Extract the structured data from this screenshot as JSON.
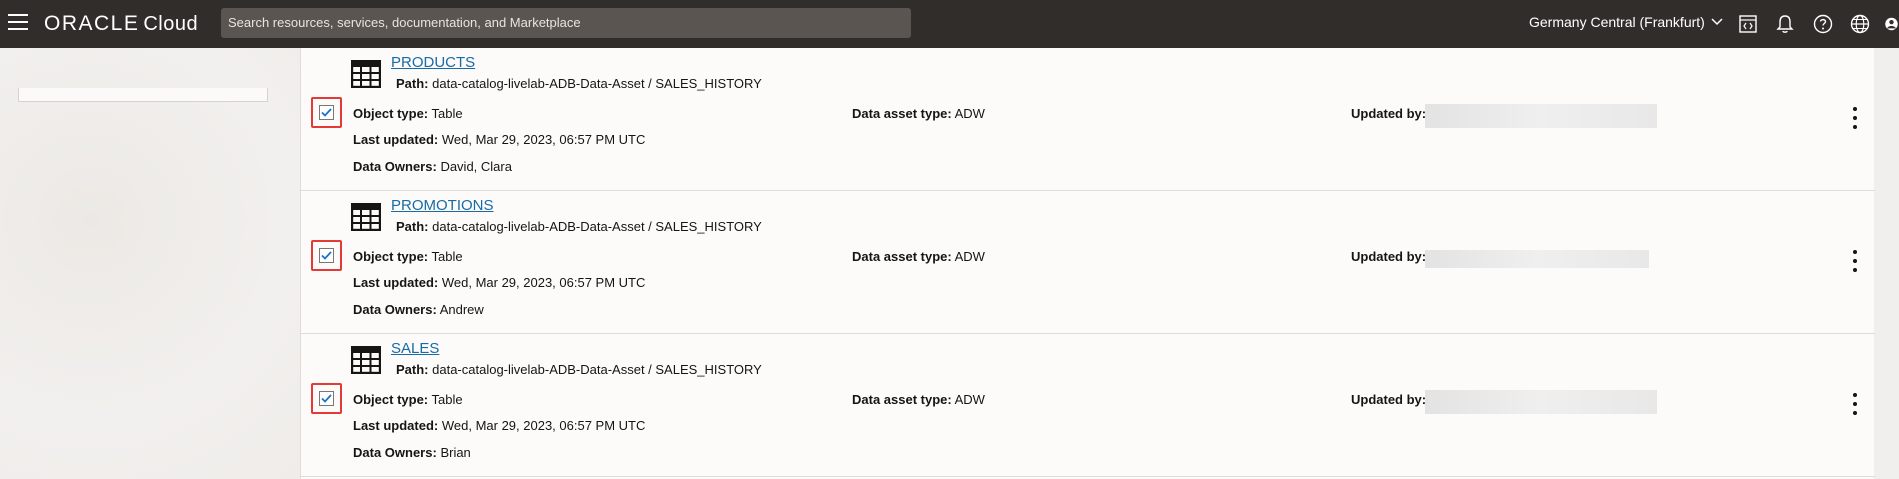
{
  "header": {
    "logo_brand": "ORACLE",
    "logo_sub": "Cloud",
    "search_placeholder": "Search resources, services, documentation, and Marketplace",
    "region": "Germany Central (Frankfurt)",
    "icons": [
      "menu-icon",
      "code-editor-icon",
      "bell-icon",
      "help-icon",
      "globe-icon",
      "profile-icon"
    ]
  },
  "results": [
    {
      "name": "PRODUCTS",
      "path_label": "Path:",
      "path": "data-catalog-livelab-ADB-Data-Asset / SALES_HISTORY",
      "object_type_label": "Object type:",
      "object_type": "Table",
      "asset_type_label": "Data asset type:",
      "asset_type": "ADW",
      "updated_by_label": "Updated by:",
      "last_updated_label": "Last updated:",
      "last_updated": "Wed, Mar 29, 2023, 06:57 PM UTC",
      "owners_label": "Data Owners:",
      "owners": "David, Clara",
      "checked": true
    },
    {
      "name": "PROMOTIONS",
      "path_label": "Path:",
      "path": "data-catalog-livelab-ADB-Data-Asset / SALES_HISTORY",
      "object_type_label": "Object type:",
      "object_type": "Table",
      "asset_type_label": "Data asset type:",
      "asset_type": "ADW",
      "updated_by_label": "Updated by:",
      "last_updated_label": "Last updated:",
      "last_updated": "Wed, Mar 29, 2023, 06:57 PM UTC",
      "owners_label": "Data Owners:",
      "owners": "Andrew",
      "checked": true
    },
    {
      "name": "SALES",
      "path_label": "Path:",
      "path": "data-catalog-livelab-ADB-Data-Asset / SALES_HISTORY",
      "object_type_label": "Object type:",
      "object_type": "Table",
      "asset_type_label": "Data asset type:",
      "asset_type": "ADW",
      "updated_by_label": "Updated by:",
      "last_updated_label": "Last updated:",
      "last_updated": "Wed, Mar 29, 2023, 06:57 PM UTC",
      "owners_label": "Data Owners:",
      "owners": "Brian",
      "checked": true
    }
  ],
  "colors": {
    "header_bg": "#312d2a",
    "link": "#176ba6",
    "highlight": "#e53935",
    "checkbox": "#1a73c8"
  }
}
